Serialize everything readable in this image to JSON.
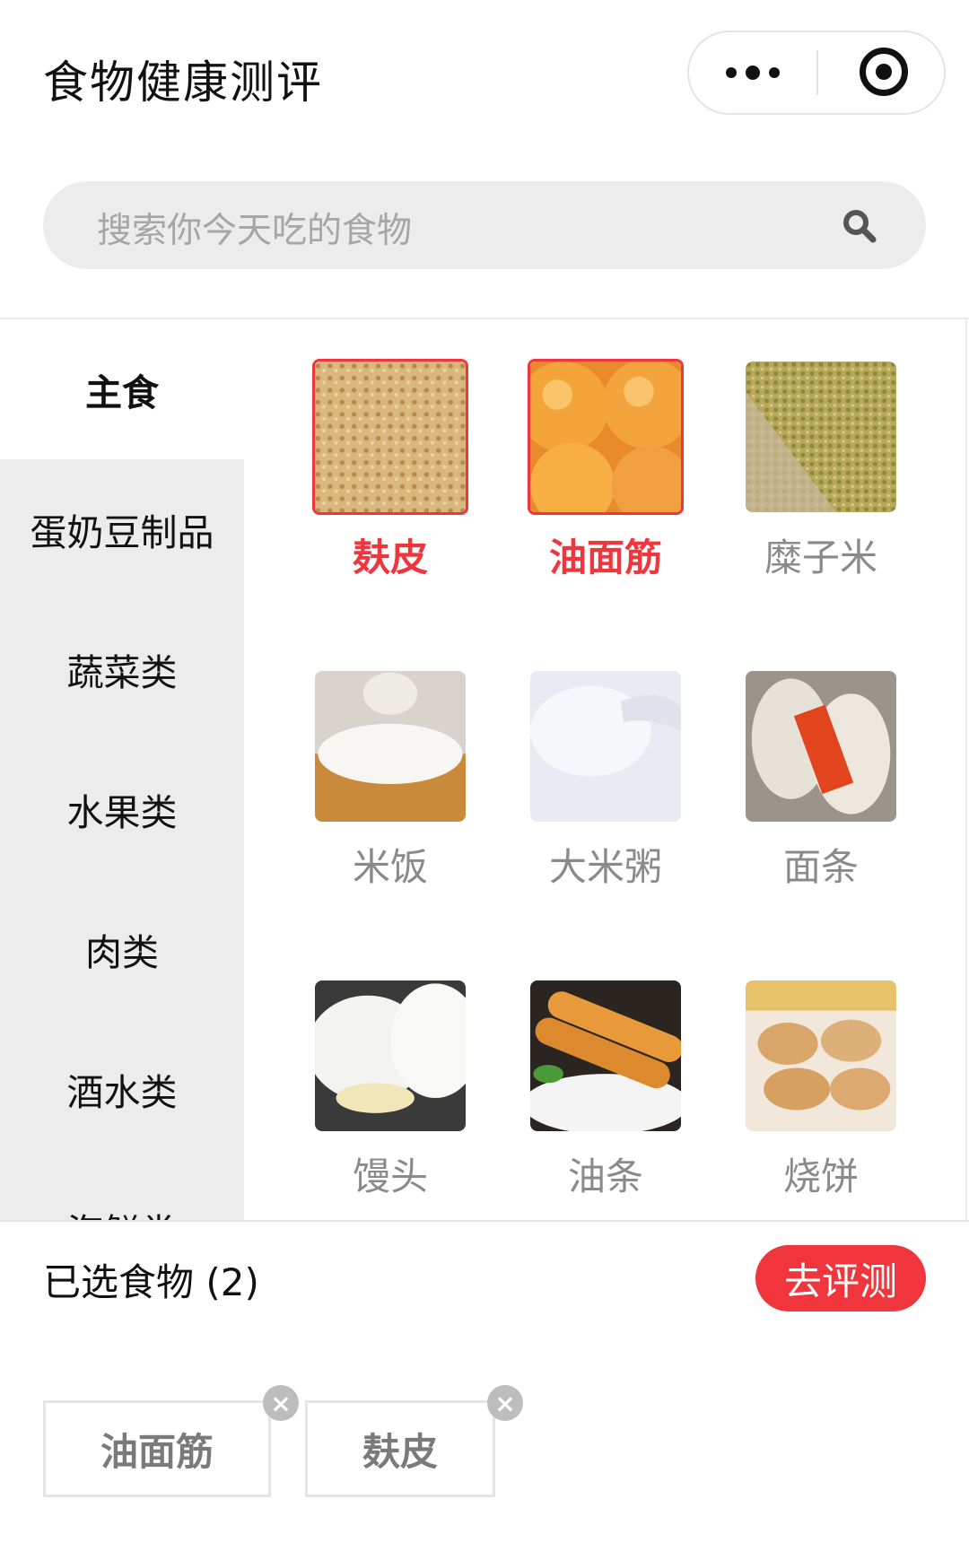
{
  "header": {
    "title": "食物健康测评",
    "more_icon": "more-dots-icon",
    "close_icon": "target-icon"
  },
  "search": {
    "placeholder": "搜索你今天吃的食物",
    "icon": "search-icon"
  },
  "sidebar": {
    "items": [
      {
        "label": "主食",
        "active": true
      },
      {
        "label": "蛋奶豆制品",
        "active": false
      },
      {
        "label": "蔬菜类",
        "active": false
      },
      {
        "label": "水果类",
        "active": false
      },
      {
        "label": "肉类",
        "active": false
      },
      {
        "label": "酒水类",
        "active": false
      },
      {
        "label": "海鲜类",
        "active": false
      }
    ]
  },
  "foods": [
    {
      "name": "麸皮",
      "selected": true
    },
    {
      "name": "油面筋",
      "selected": true
    },
    {
      "name": "糜子米",
      "selected": false
    },
    {
      "name": "米饭",
      "selected": false
    },
    {
      "name": "大米粥",
      "selected": false
    },
    {
      "name": "面条",
      "selected": false
    },
    {
      "name": "馒头",
      "selected": false
    },
    {
      "name": "油条",
      "selected": false
    },
    {
      "name": "烧饼",
      "selected": false
    }
  ],
  "selection": {
    "title": "已选食物 (2)",
    "evaluate_label": "去评测",
    "chips": [
      {
        "label": "油面筋"
      },
      {
        "label": "麸皮"
      }
    ],
    "remove_symbol": "×"
  },
  "colors": {
    "accent": "#f0363c",
    "sidebar_bg": "#ececec",
    "muted_text": "#8a8a8a"
  }
}
